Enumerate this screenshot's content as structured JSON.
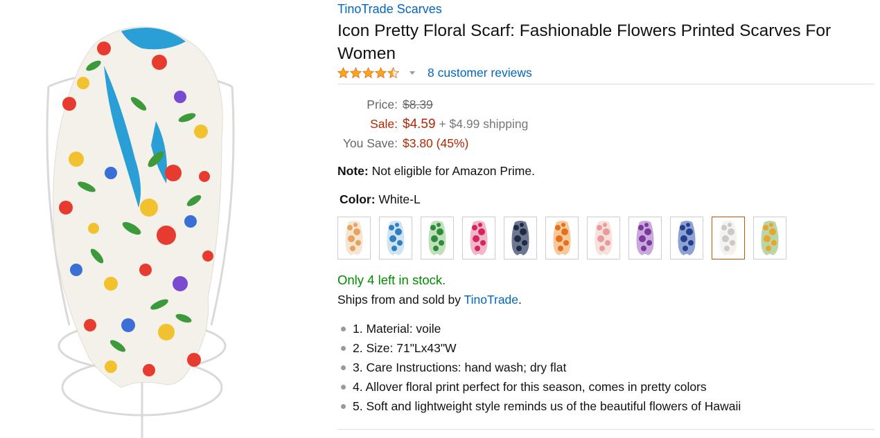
{
  "brand": "TinoTrade Scarves",
  "title": "Icon Pretty Floral Scarf: Fashionable Flowers Printed Scarves For Women",
  "rating": {
    "value_stars": 4.5,
    "max_stars": 5,
    "reviews_link": "8 customer reviews"
  },
  "price": {
    "list_label": "Price:",
    "list_value": "$8.39",
    "sale_label": "Sale:",
    "sale_value": "$4.59",
    "shipping": "+ $4.99 shipping",
    "save_label": "You Save:",
    "save_value": "$3.80 (45%)"
  },
  "note": {
    "label": "Note:",
    "text": " Not eligible for Amazon Prime."
  },
  "color": {
    "label": "Color:",
    "value": " White-L",
    "swatches": [
      {
        "accent": "#e9a25a",
        "base": "#f3e6d6"
      },
      {
        "accent": "#2f7fc1",
        "base": "#cfe3f2"
      },
      {
        "accent": "#2e8b3e",
        "base": "#bfe0b8"
      },
      {
        "accent": "#d6245e",
        "base": "#f1b7c8"
      },
      {
        "accent": "#1f2a44",
        "base": "#6d7890"
      },
      {
        "accent": "#e46f1c",
        "base": "#f6c89a"
      },
      {
        "accent": "#e99a9a",
        "base": "#f7e1dc"
      },
      {
        "accent": "#7a3a9a",
        "base": "#c9a8de"
      },
      {
        "accent": "#253f8f",
        "base": "#8ea2d4"
      },
      {
        "accent": "#c9c9c9",
        "base": "#f4f1ee"
      },
      {
        "accent": "#e9a52a",
        "base": "#b8d6a6"
      }
    ],
    "selected_index": 9
  },
  "stock": "Only 4 left in stock.",
  "ships": {
    "prefix": "Ships from and sold by ",
    "seller": "TinoTrade",
    "suffix": "."
  },
  "bullets": [
    "1. Material: voile",
    "2. Size: 71\"Lx43\"W",
    "3. Care Instructions: hand wash; dry flat",
    "4. Allover floral print perfect for this season, comes in pretty colors",
    "5. Soft and lightweight style reminds us of the beautiful flowers of Hawaii"
  ],
  "colors": {
    "link": "#0066c0",
    "price_red": "#b12704",
    "stock_green": "#008a00",
    "star": "#ffa41c"
  }
}
